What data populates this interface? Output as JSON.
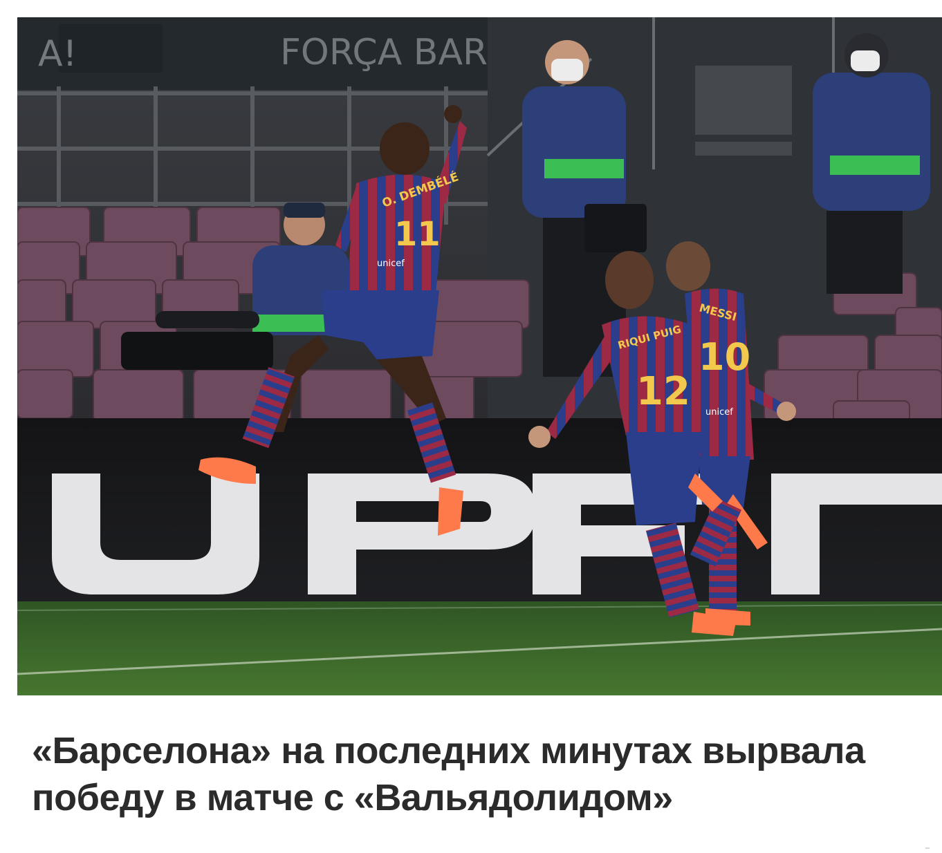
{
  "article": {
    "headline": "«Барселона» на последних минутах вырвала победу в матче с «Вальядолидом»",
    "image": {
      "banner_text": "FORÇA BARÇA",
      "board_text": "UPFRA",
      "players": [
        {
          "name_on_shirt": "O. DEMBÉLÉ",
          "number": "11"
        },
        {
          "name_on_shirt": "RIQUI PUIG",
          "number": "12"
        },
        {
          "name_on_shirt": "MESSI",
          "number": "10"
        }
      ],
      "sponsor": "unicef"
    }
  },
  "colors": {
    "headline": "#2b2b2b",
    "barca_blue": "#2a3e8c",
    "barca_red": "#9c2a45",
    "seat": "#6e4a5e",
    "pitch": "#3f6b2e",
    "steward_vest": "#2c3f78",
    "steward_stripe": "#3bbf55"
  }
}
